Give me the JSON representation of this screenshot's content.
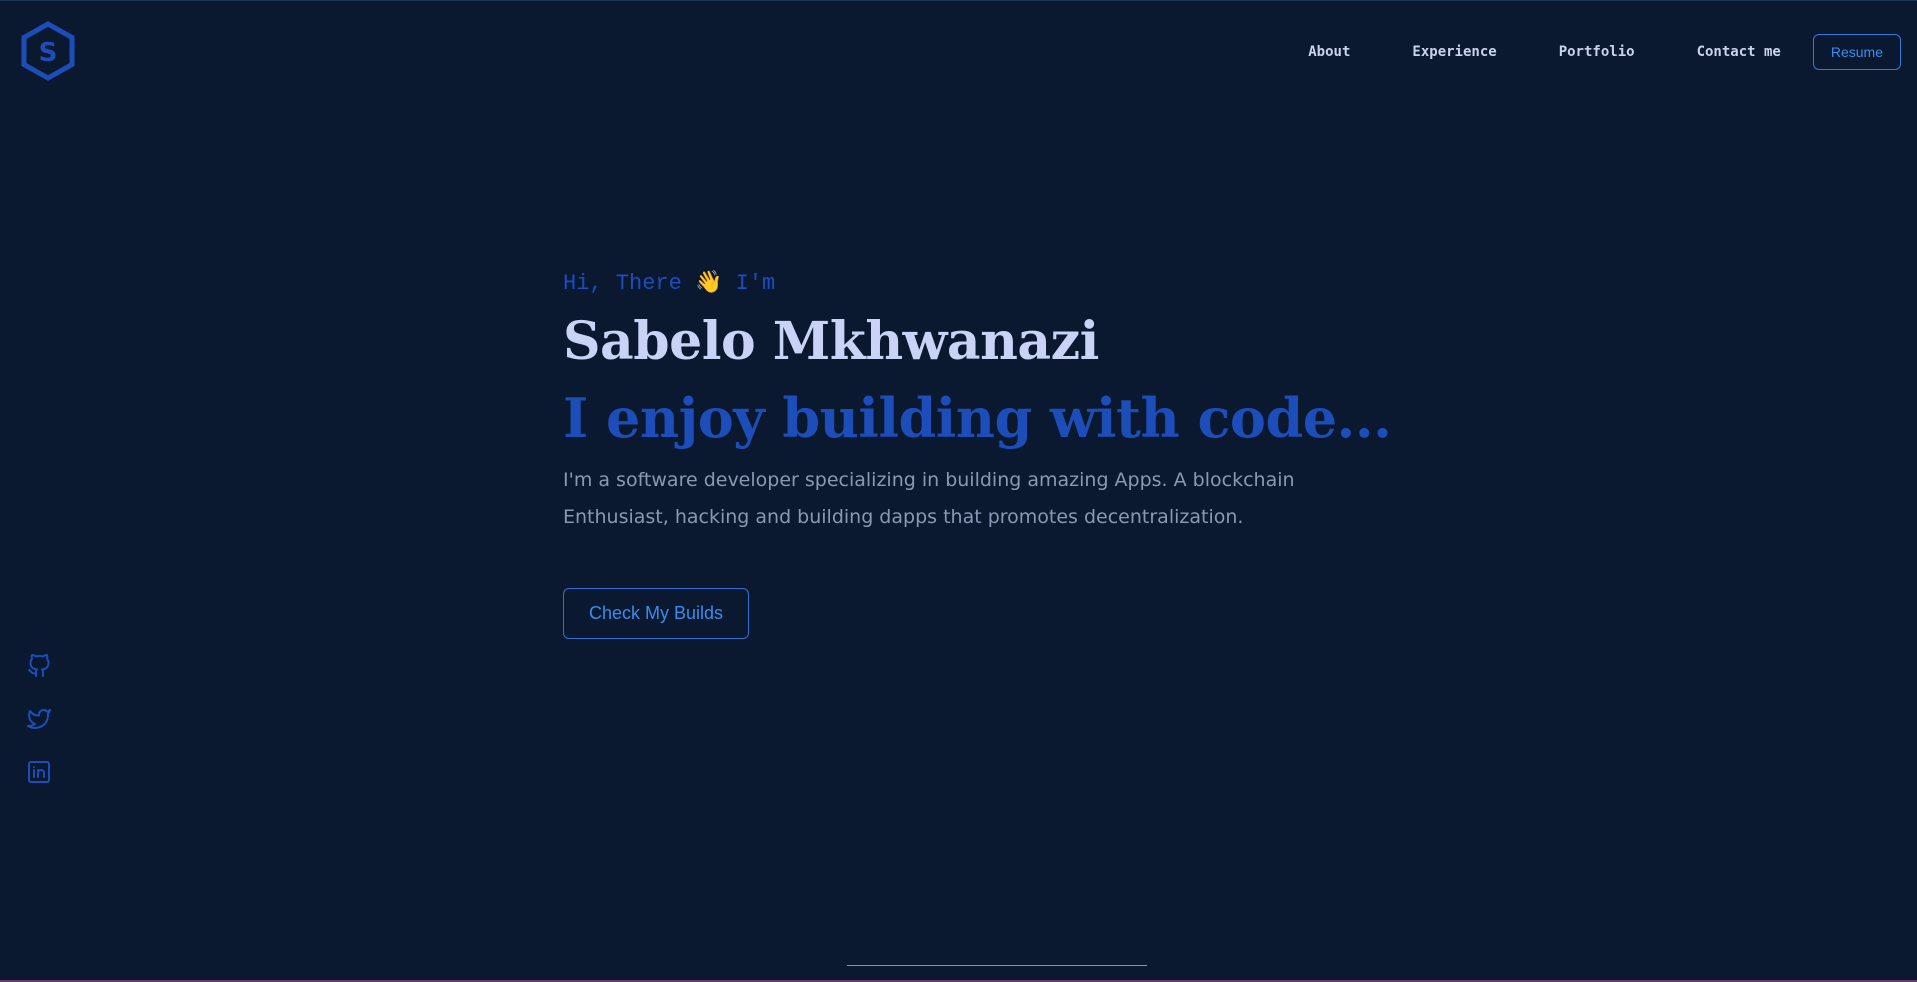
{
  "header": {
    "logo_letter": "S",
    "nav": [
      "About",
      "Experience",
      "Portfolio",
      "Contact me"
    ],
    "resume_label": "Resume"
  },
  "hero": {
    "greeting": "Hi, There 👋 I'm",
    "name": "Sabelo Mkhwanazi",
    "tagline": "I enjoy building with code...",
    "description": "I'm a software developer specializing in building amazing Apps. A blockchain Enthusiast, hacking and building dapps that promotes decentralization.",
    "cta_label": "Check My Builds"
  },
  "socials": [
    {
      "icon": "github-icon"
    },
    {
      "icon": "twitter-icon"
    },
    {
      "icon": "linkedin-icon"
    }
  ],
  "colors": {
    "background": "#0b1930",
    "accent": "#1d4db8",
    "accent_light": "#3a8bf0",
    "name_text": "#c9d3f5",
    "body_text": "#8c98b3"
  }
}
